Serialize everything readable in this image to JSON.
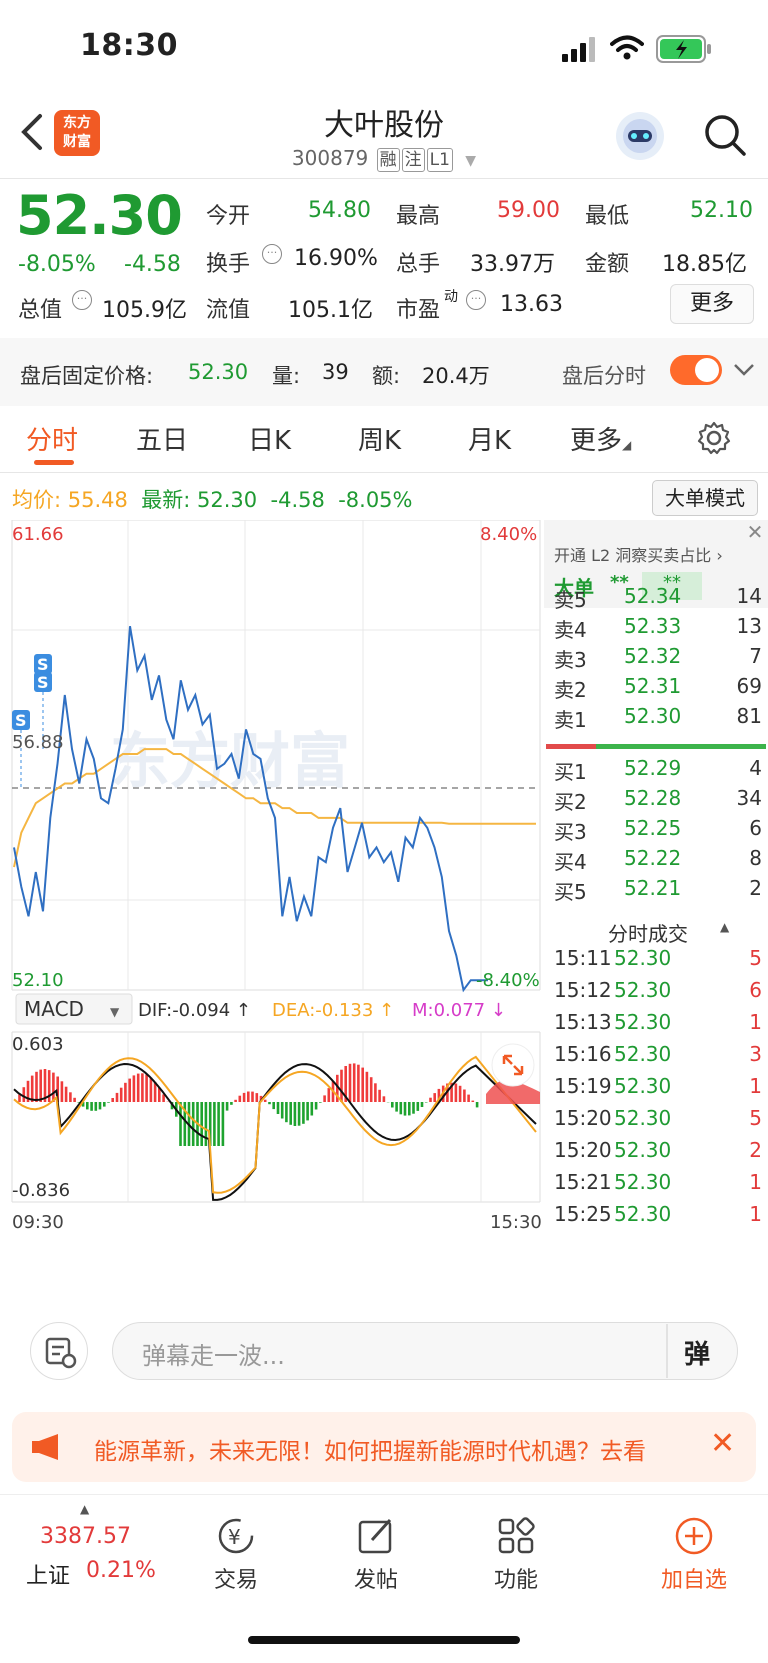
{
  "status": {
    "time": "18:30"
  },
  "header": {
    "title": "大叶股份",
    "code": "300879",
    "tags": [
      "融",
      "注",
      "L1"
    ],
    "logo_line1": "东方",
    "logo_line2": "财富"
  },
  "quote": {
    "price": "52.30",
    "change_pct": "-8.05%",
    "change": "-4.58",
    "open_label": "今开",
    "open": "54.80",
    "high_label": "最高",
    "high": "59.00",
    "low_label": "最低",
    "low": "52.10",
    "turnover_rate_label": "换手",
    "turnover_rate": "16.90%",
    "volume_label": "总手",
    "volume": "33.97万",
    "amount_label": "金额",
    "amount": "18.85亿",
    "mcap_label": "总值",
    "mcap": "105.9亿",
    "float_label": "流值",
    "float_cap": "105.1亿",
    "pe_label": "市盈",
    "pe_sup": "动",
    "pe": "13.63",
    "more_label": "更多"
  },
  "after_hours": {
    "price_label": "盘后固定价格:",
    "price": "52.30",
    "vol_label": "量:",
    "vol": "39",
    "amt_label": "额:",
    "amt": "20.4万",
    "timeshare_label": "盘后分时"
  },
  "tabs": [
    "分时",
    "五日",
    "日K",
    "周K",
    "月K",
    "更多"
  ],
  "chart_info": {
    "avg_label": "均价:",
    "avg": "55.48",
    "latest_label": "最新:",
    "latest": "52.30",
    "chg": "-4.58",
    "pct": "-8.05%",
    "big_order_btn": "大单模式"
  },
  "chart_labels": {
    "ymax": "61.66",
    "ymid": "56.88",
    "ymin": "52.10",
    "pct_max": "8.40%",
    "pct_min": "-8.40%",
    "macd": "MACD",
    "dif": "DIF:-0.094 ↑",
    "dea": "DEA:-0.133 ↑",
    "m": "M:0.077 ↓",
    "macd_max": "0.603",
    "macd_min": "-0.836",
    "t_start": "09:30",
    "t_end": "15:30",
    "watermark": "东方财富"
  },
  "chart_data": {
    "type": "line",
    "x_range": [
      "09:30",
      "15:00"
    ],
    "ylim": [
      52.1,
      61.66
    ],
    "prev_close": 56.88,
    "series": [
      {
        "name": "price",
        "values": [
          55.0,
          54.2,
          53.6,
          54.5,
          53.7,
          55.6,
          56.7,
          58.1,
          57.0,
          56.3,
          57.2,
          56.8,
          56.0,
          55.9,
          56.6,
          57.4,
          59.5,
          58.6,
          58.9,
          58.0,
          58.5,
          57.6,
          57.2,
          58.4,
          57.8,
          58.1,
          57.5,
          57.7,
          56.6,
          56.7,
          56.9,
          56.4,
          57.4,
          56.9,
          56.8,
          56.0,
          55.6,
          53.6,
          54.4,
          53.5,
          54.0,
          53.6,
          54.8,
          54.7,
          55.4,
          55.8,
          54.5,
          55.0,
          55.5,
          54.8,
          55.0,
          54.7,
          54.9,
          54.3,
          55.2,
          55.0,
          55.6,
          55.4,
          55.0,
          54.4,
          53.3,
          52.8,
          52.1,
          52.3,
          52.3
        ]
      },
      {
        "name": "avg",
        "values": [
          54.6,
          55.3,
          55.6,
          55.9,
          56.0,
          56.1,
          56.2,
          56.3,
          56.3,
          56.4,
          56.5,
          56.5,
          56.6,
          56.7,
          56.8,
          56.9,
          56.9,
          56.9,
          57.0,
          57.0,
          57.0,
          57.0,
          56.9,
          56.9,
          56.8,
          56.7,
          56.6,
          56.5,
          56.4,
          56.3,
          56.2,
          56.1,
          56.0,
          56.0,
          55.9,
          55.9,
          55.9,
          55.8,
          55.8,
          55.7,
          55.7,
          55.7,
          55.6,
          55.6,
          55.6,
          55.6,
          55.5,
          55.5,
          55.5,
          55.5,
          55.5,
          55.5,
          55.5,
          55.5,
          55.5,
          55.5,
          55.5,
          55.5,
          55.5,
          55.5,
          55.48,
          55.48,
          55.48,
          55.48,
          55.48
        ]
      }
    ]
  },
  "panel": {
    "l2_text": "开通 L2 洞察买卖占比 ›",
    "big_label": "大单",
    "big_val1": "**",
    "big_val2": "**",
    "asks": [
      {
        "label": "卖5",
        "price": "52.34",
        "vol": "14"
      },
      {
        "label": "卖4",
        "price": "52.33",
        "vol": "13"
      },
      {
        "label": "卖3",
        "price": "52.32",
        "vol": "7"
      },
      {
        "label": "卖2",
        "price": "52.31",
        "vol": "69"
      },
      {
        "label": "卖1",
        "price": "52.30",
        "vol": "81"
      }
    ],
    "bids": [
      {
        "label": "买1",
        "price": "52.29",
        "vol": "4"
      },
      {
        "label": "买2",
        "price": "52.28",
        "vol": "34"
      },
      {
        "label": "买3",
        "price": "52.25",
        "vol": "6"
      },
      {
        "label": "买4",
        "price": "52.22",
        "vol": "8"
      },
      {
        "label": "买5",
        "price": "52.21",
        "vol": "2"
      }
    ],
    "trades_title": "分时成交",
    "trades": [
      {
        "time": "15:11",
        "price": "52.30",
        "vol": "5"
      },
      {
        "time": "15:12",
        "price": "52.30",
        "vol": "6"
      },
      {
        "time": "15:13",
        "price": "52.30",
        "vol": "1"
      },
      {
        "time": "15:16",
        "price": "52.30",
        "vol": "3"
      },
      {
        "time": "15:19",
        "price": "52.30",
        "vol": "1"
      },
      {
        "time": "15:20",
        "price": "52.30",
        "vol": "5"
      },
      {
        "time": "15:20",
        "price": "52.30",
        "vol": "2"
      },
      {
        "time": "15:21",
        "price": "52.30",
        "vol": "1"
      },
      {
        "time": "15:25",
        "price": "52.30",
        "vol": "1"
      }
    ]
  },
  "comment": {
    "placeholder": "弹幕走一波...",
    "danmu_btn": "弹"
  },
  "banner": {
    "text": "能源革新，未来无限！如何把握新能源时代机遇？去看"
  },
  "nav": {
    "index_value": "3387.57",
    "index_name": "上证",
    "index_pct": "0.21%",
    "items": [
      "交易",
      "发帖",
      "功能",
      "加自选"
    ]
  },
  "colors": {
    "up": "#e23a3a",
    "down": "#1f9a32",
    "accent": "#f15a24",
    "avg_line": "#f5b642",
    "price_line": "#2f6fc2"
  }
}
